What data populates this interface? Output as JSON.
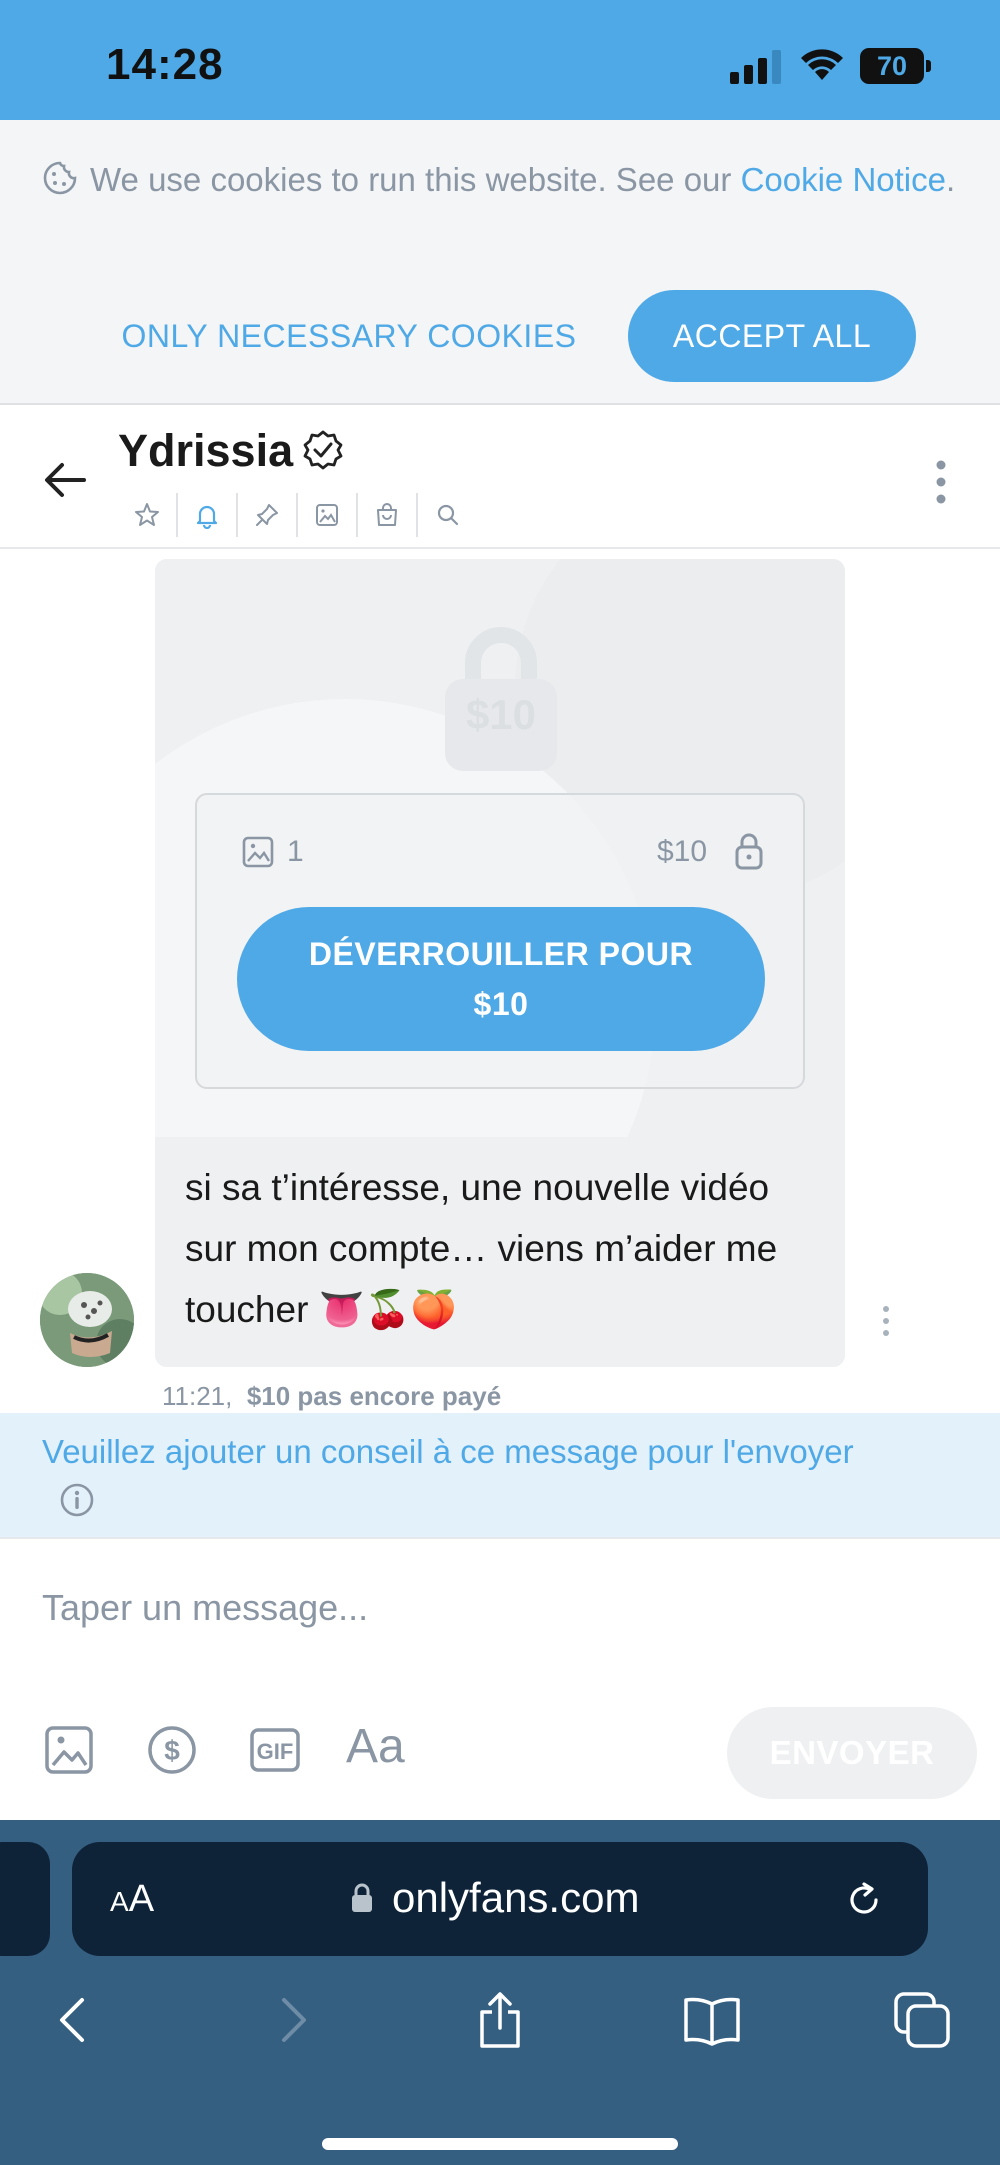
{
  "status_bar": {
    "time": "14:28",
    "battery": "70"
  },
  "cookie_banner": {
    "text": "We use cookies to run this website. See our ",
    "link": "Cookie Notice",
    "after": ".",
    "necessary_button": "ONLY NECESSARY COOKIES",
    "accept_button": "ACCEPT ALL"
  },
  "chat_header": {
    "name": "Ydrissia",
    "tools": [
      "star-icon",
      "bell-icon",
      "pin-icon",
      "image-icon",
      "shop-icon",
      "search-icon"
    ]
  },
  "message": {
    "preview_price": "$10",
    "media_count": "1",
    "price": "$10",
    "unlock_button": "DÉVERROUILLER POUR $10",
    "text": "si sa t’intéresse, une nouvelle vidéo sur mon compte… viens m’aider me toucher 👅🍒🍑",
    "time": "11:21,",
    "status": "$10 pas encore payé"
  },
  "tip_notice": {
    "text": "Veuillez ajouter un conseil à ce message pour l'envoyer"
  },
  "composer": {
    "placeholder": "Taper un message...",
    "font_button": "Aa",
    "send_button": "ENVOYER"
  },
  "browser": {
    "aa_label_small": "A",
    "aa_label_large": "A",
    "url": "onlyfans.com"
  },
  "colors": {
    "accent": "#4fa9e6",
    "muted": "#8a96a3",
    "browser_bg": "#355f81",
    "urlbar_bg": "#0e2238"
  }
}
